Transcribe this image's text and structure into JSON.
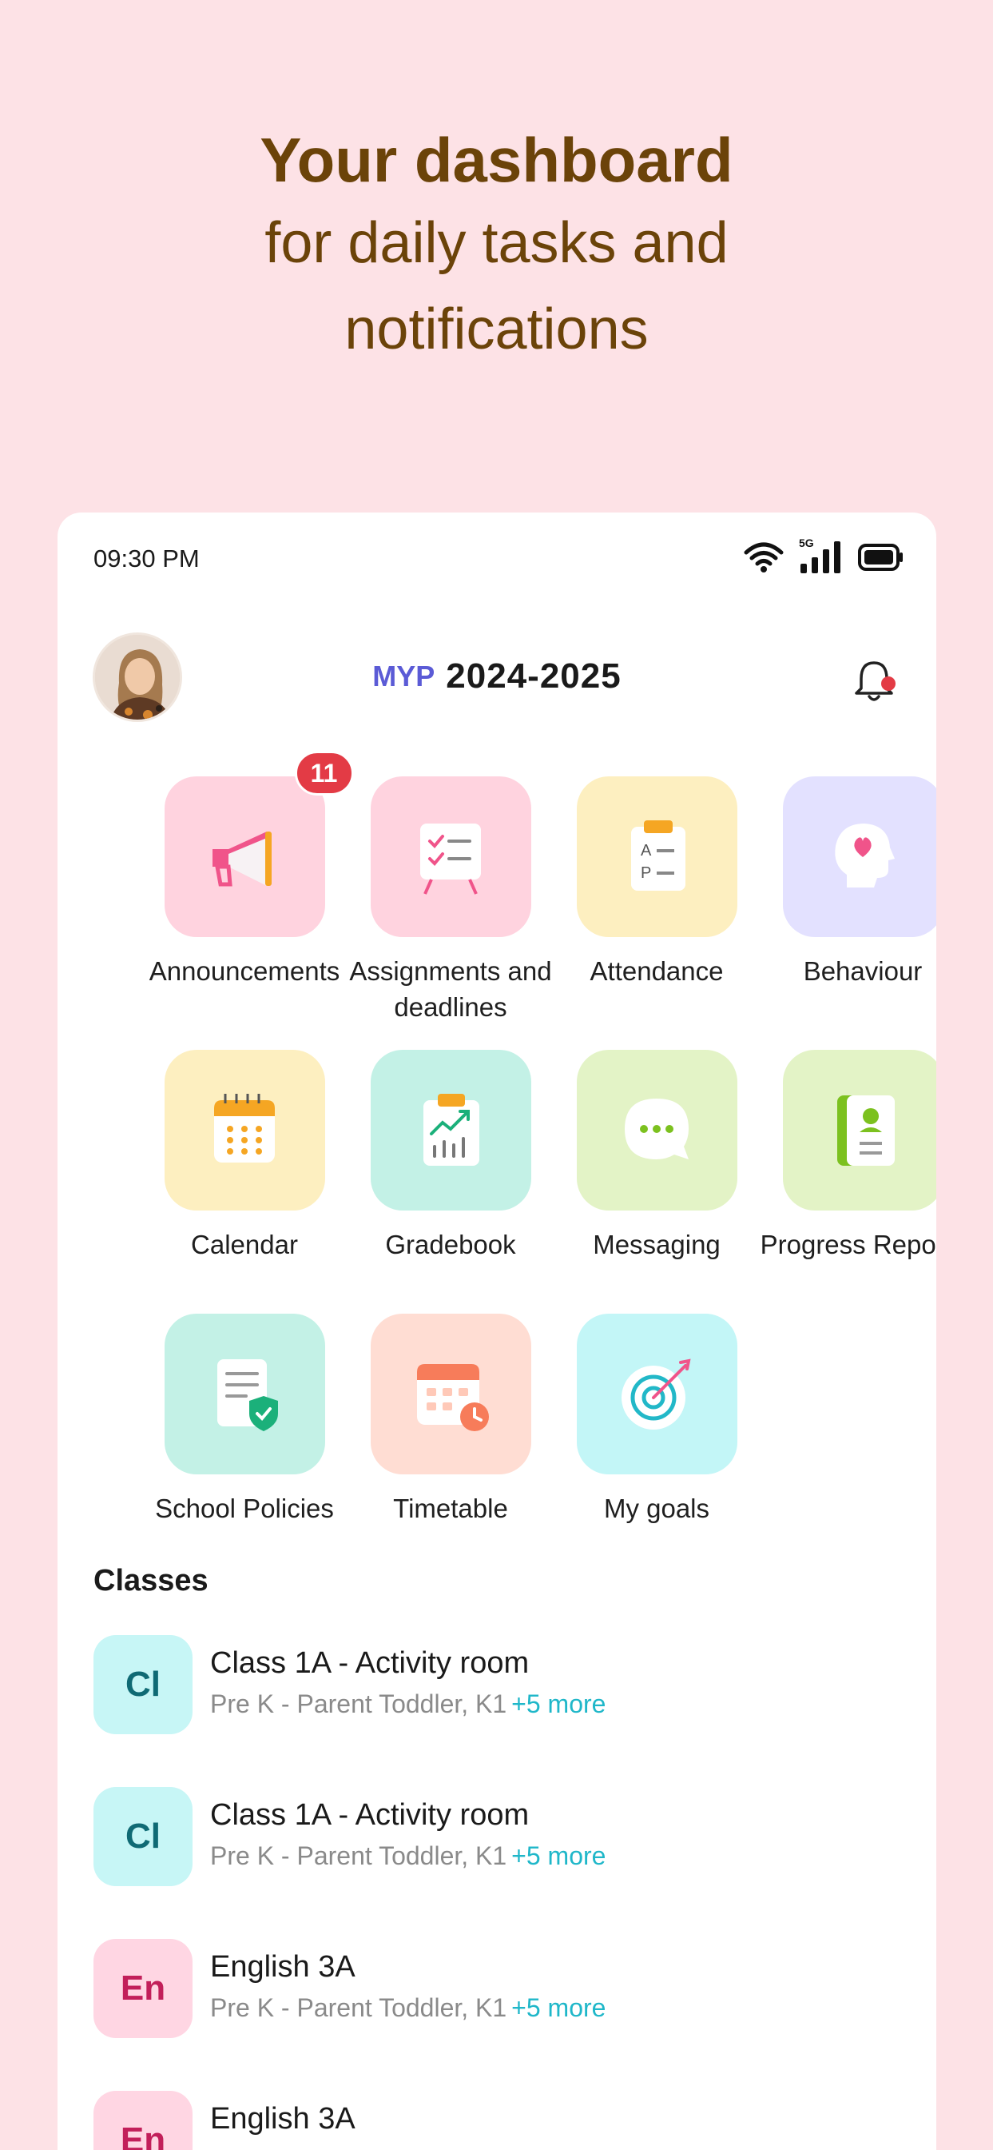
{
  "hero": {
    "title": "Your dashboard",
    "subtitle": "for daily tasks and notifications"
  },
  "status_bar": {
    "time": "09:30 PM",
    "network": "5G",
    "icons": [
      "wifi-icon",
      "signal-icon",
      "battery-icon"
    ]
  },
  "header": {
    "program": "MYP",
    "year": "2024-2025",
    "has_notification": true
  },
  "tiles": [
    {
      "label": "Announcements",
      "icon": "megaphone-icon",
      "bg": "#ffd3df",
      "badge": "11"
    },
    {
      "label": "Assignments and deadlines",
      "icon": "checklist-board-icon",
      "bg": "#ffd3df"
    },
    {
      "label": "Attendance",
      "icon": "clipboard-ap-icon",
      "bg": "#fdefc0"
    },
    {
      "label": "Behaviour",
      "icon": "head-heart-icon",
      "bg": "#e3e1ff"
    },
    {
      "label": "Calendar",
      "icon": "calendar-icon",
      "bg": "#fdefc0"
    },
    {
      "label": "Gradebook",
      "icon": "gradebook-chart-icon",
      "bg": "#c3f1e6"
    },
    {
      "label": "Messaging",
      "icon": "chat-bubble-icon",
      "bg": "#e3f3c6"
    },
    {
      "label": "Progress Reports",
      "icon": "report-book-icon",
      "bg": "#e3f3c6"
    },
    {
      "label": "School Policies",
      "icon": "policy-shield-icon",
      "bg": "#c3f1e6"
    },
    {
      "label": "Timetable",
      "icon": "timetable-clock-icon",
      "bg": "#ffddd3"
    },
    {
      "label": "My goals",
      "icon": "target-icon",
      "bg": "#c3f6f7"
    }
  ],
  "classes": {
    "title": "Classes",
    "items": [
      {
        "initials": "Cl",
        "name": "Class 1A - Activity room",
        "sub": "Pre K - Parent Toddler, K1",
        "more": "+5 more",
        "bg": "#c7f6f6",
        "fg": "#0f6a74"
      },
      {
        "initials": "Cl",
        "name": "Class 1A - Activity room",
        "sub": "Pre K - Parent Toddler, K1",
        "more": "+5 more",
        "bg": "#c7f6f6",
        "fg": "#0f6a74"
      },
      {
        "initials": "En",
        "name": "English 3A",
        "sub": "Pre K - Parent Toddler, K1",
        "more": "+5 more",
        "bg": "#ffd6e3",
        "fg": "#c21f5a"
      },
      {
        "initials": "En",
        "name": "English 3A",
        "sub": "",
        "more": "",
        "bg": "#ffd6e3",
        "fg": "#c21f5a"
      }
    ]
  }
}
